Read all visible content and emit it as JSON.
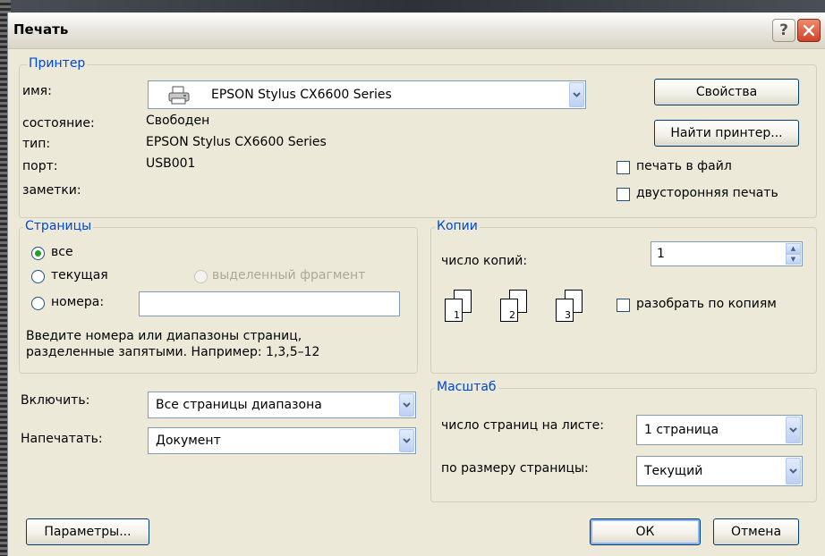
{
  "title": "Печать",
  "printer": {
    "legend": "Принтер",
    "name_label": "имя:",
    "name_value": "EPSON Stylus CX6600 Series",
    "status_label": "состояние:",
    "status_value": "Свободен",
    "type_label": "тип:",
    "type_value": "EPSON Stylus CX6600 Series",
    "port_label": "порт:",
    "port_value": "USB001",
    "notes_label": "заметки:",
    "properties_button": "Свойства",
    "find_button": "Найти принтер...",
    "print_to_file": "печать в файл",
    "duplex": "двусторонняя печать"
  },
  "pages": {
    "legend": "Страницы",
    "all": "все",
    "current": "текущая",
    "selection": "выделенный фрагмент",
    "numbers": "номера:",
    "numbers_value": "",
    "hint_line1": "Введите номера или диапазоны страниц,",
    "hint_line2": "разделенные запятыми. Например: 1,3,5–12",
    "selected": "all"
  },
  "copies": {
    "legend": "Копии",
    "count_label": "число копий:",
    "count_value": "1",
    "collate": "разобрать по копиям",
    "collate_checked": false,
    "page_numbers": [
      "1",
      "2",
      "3"
    ]
  },
  "include": {
    "label": "Включить:",
    "value": "Все страницы диапазона"
  },
  "print_what": {
    "label": "Напечатать:",
    "value": "Документ"
  },
  "zoom": {
    "legend": "Масштаб",
    "pages_per_sheet_label": "число страниц на листе:",
    "pages_per_sheet_value": "1 страница",
    "scale_label": "по размеру страницы:",
    "scale_value": "Текущий"
  },
  "buttons": {
    "options": "Параметры...",
    "ok": "ОК",
    "cancel": "Отмена"
  },
  "icons": {
    "help": "help-icon",
    "close": "close-icon",
    "printer": "printer-icon",
    "dropdown": "chevron-down-icon"
  },
  "colors": {
    "legend_blue": "#0046d5",
    "dialog_bg": "#ece9d8",
    "close_red": "#d0422a"
  }
}
